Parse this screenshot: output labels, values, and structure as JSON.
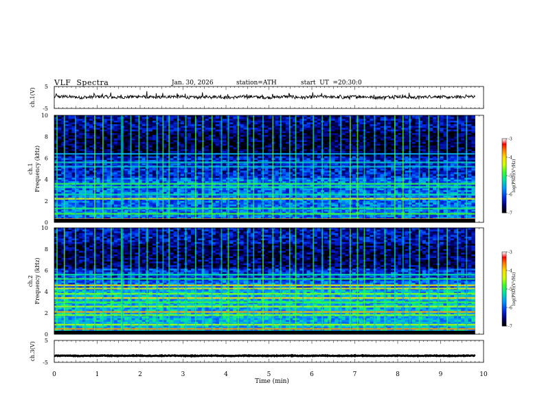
{
  "header": {
    "title": "VLF  Spectra",
    "date": "Jan. 30, 2026",
    "station": "station=ATH",
    "start_label": "start  UT  =",
    "start_time": "20:30:0"
  },
  "chart_data": [
    {
      "type": "line",
      "name": "ch1-waveform",
      "ylabel": "ch.1(V)",
      "yticks": [
        "5",
        "-5"
      ],
      "ylim": [
        -5,
        5
      ],
      "xlim": [
        0,
        10
      ],
      "x_end_min": 9.8,
      "mean_v": 0.2,
      "noise_amp_v": 0.7,
      "color": "#000000"
    },
    {
      "type": "heatmap",
      "name": "ch1-spectrogram",
      "ylabel": "ch.1\nFrequency (kHz)",
      "ylim": [
        0,
        10
      ],
      "yticks": [
        "0",
        "2",
        "4",
        "6",
        "8",
        "10"
      ],
      "xlim": [
        0,
        10
      ],
      "x_end_min": 9.8,
      "colorbar": {
        "label": "log(PSD)(V²/Hz)",
        "range": [
          -7,
          -3
        ],
        "ticks": [
          "-3",
          "-4",
          "-5",
          "-6",
          "-7"
        ],
        "colors": [
          "#000000",
          "#0000aa",
          "#0055ff",
          "#00bbff",
          "#00ff66",
          "#ccff00",
          "#ffff00",
          "#ff8800",
          "#ff0000",
          "#ff9999",
          "#ffffff"
        ]
      },
      "bands_khz": [
        {
          "f": 0.3,
          "level": -3.6
        },
        {
          "f": 0.8,
          "level": -4.8
        },
        {
          "f": 1.3,
          "level": -5.0
        },
        {
          "f": 2.2,
          "level": -4.3
        },
        {
          "f": 2.6,
          "level": -5.2
        },
        {
          "f": 3.3,
          "level": -5.1
        },
        {
          "f": 3.6,
          "level": -4.9
        },
        {
          "f": 5.2,
          "level": -5.5
        },
        {
          "f": 5.6,
          "level": -5.4
        },
        {
          "f": 6.4,
          "level": -5.6
        }
      ]
    },
    {
      "type": "heatmap",
      "name": "ch2-spectrogram",
      "ylabel": "ch.2\nFrequency (kHz)",
      "ylim": [
        0,
        10
      ],
      "yticks": [
        "0",
        "2",
        "4",
        "6",
        "8",
        "10"
      ],
      "xlim": [
        0,
        10
      ],
      "x_end_min": 9.8,
      "colorbar": {
        "label": "log(PSD)(V²/Hz)",
        "range": [
          -7,
          -3
        ],
        "ticks": [
          "-3",
          "-4",
          "-5",
          "-6",
          "-7"
        ],
        "colors": [
          "#000000",
          "#0000aa",
          "#0055ff",
          "#00bbff",
          "#00ff66",
          "#ccff00",
          "#ffff00",
          "#ff8800",
          "#ff0000",
          "#ff9999",
          "#ffffff"
        ]
      },
      "bands_khz": [
        {
          "f": 0.5,
          "level": -3.7
        },
        {
          "f": 0.9,
          "level": -4.5
        },
        {
          "f": 1.8,
          "level": -4.6
        },
        {
          "f": 2.1,
          "level": -3.8
        },
        {
          "f": 2.6,
          "level": -4.5
        },
        {
          "f": 3.0,
          "level": -4.8
        },
        {
          "f": 3.4,
          "level": -4.0
        },
        {
          "f": 3.8,
          "level": -4.6
        },
        {
          "f": 4.3,
          "level": -4.3
        },
        {
          "f": 4.6,
          "level": -4.1
        },
        {
          "f": 5.2,
          "level": -5.0
        },
        {
          "f": 5.6,
          "level": -5.2
        }
      ]
    },
    {
      "type": "line",
      "name": "ch3-waveform",
      "ylabel": "ch.3(V)",
      "yticks": [
        "5",
        "-5"
      ],
      "ylim": [
        -5,
        5
      ],
      "xlim": [
        0,
        10
      ],
      "x_end_min": 9.8,
      "mean_v": -2.0,
      "noise_amp_v": 0.15,
      "color": "#000000"
    }
  ],
  "x_axis": {
    "label": "Time  (min)",
    "ticks": [
      "0",
      "1",
      "2",
      "3",
      "4",
      "5",
      "6",
      "7",
      "8",
      "9",
      "10"
    ]
  },
  "spherics_min": [
    0.05,
    0.22,
    0.48,
    0.71,
    0.93,
    1.12,
    1.31,
    1.55,
    1.58,
    1.77,
    1.96,
    2.15,
    2.38,
    2.52,
    2.66,
    2.87,
    3.05,
    3.28,
    3.45,
    3.66,
    3.88,
    4.04,
    4.27,
    4.49,
    4.63,
    4.85,
    5.08,
    5.26,
    5.47,
    5.61,
    5.78,
    6.02,
    6.23,
    6.41,
    6.66,
    6.88,
    7.05,
    7.21,
    7.45,
    7.69,
    7.92,
    8.11,
    8.27,
    8.49,
    8.71,
    8.93,
    9.14,
    9.38,
    9.59
  ]
}
